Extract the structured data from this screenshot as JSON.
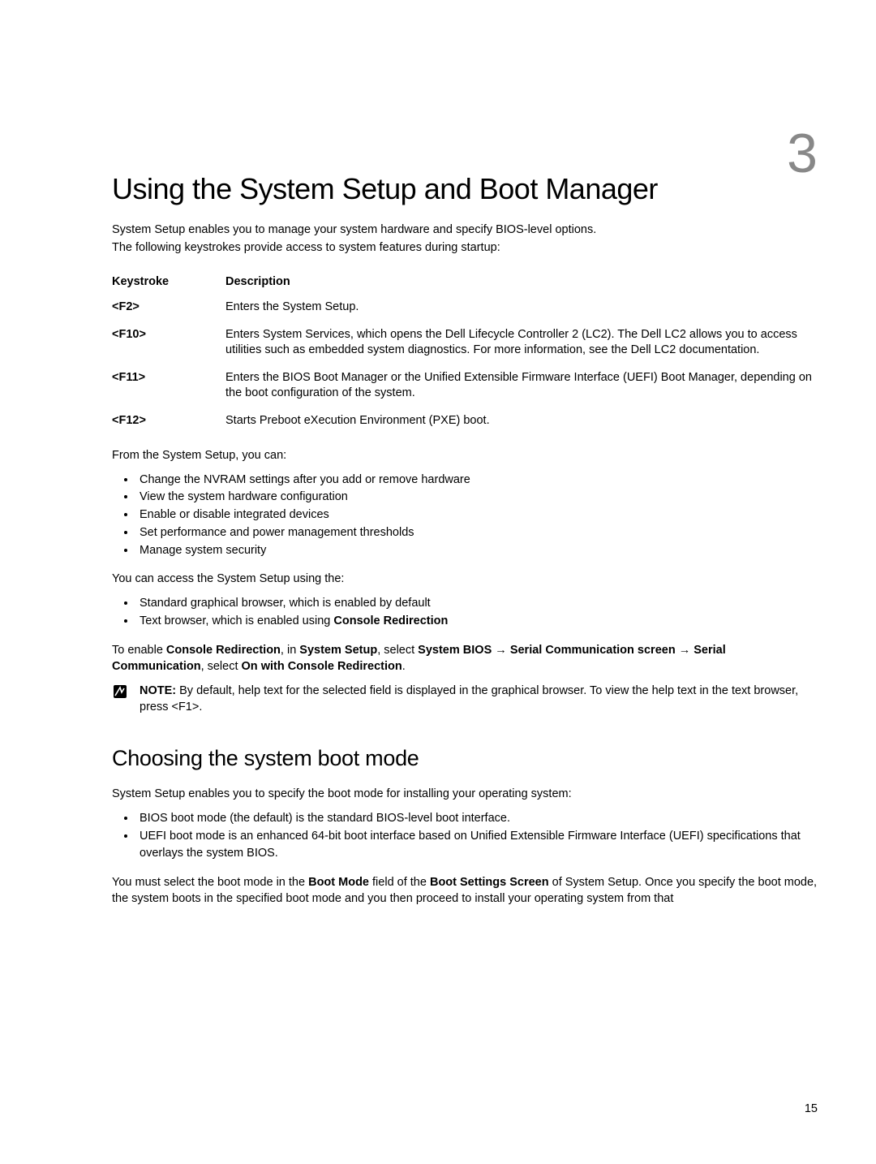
{
  "chapter_number": "3",
  "title": "Using the System Setup and Boot Manager",
  "intro": {
    "p1": "System Setup enables you to manage your system hardware and specify BIOS-level options.",
    "p2": "The following keystrokes provide access to system features during startup:"
  },
  "keystroke_table": {
    "headers": {
      "key": "Keystroke",
      "desc": "Description"
    },
    "rows": [
      {
        "key": "<F2>",
        "desc": "Enters the System Setup."
      },
      {
        "key": "<F10>",
        "desc": "Enters System Services, which opens the Dell Lifecycle Controller 2 (LC2). The Dell LC2 allows you to access utilities such as embedded system diagnostics. For more information, see the Dell LC2 documentation."
      },
      {
        "key": "<F11>",
        "desc": "Enters the BIOS Boot Manager or the Unified Extensible Firmware Interface (UEFI) Boot Manager, depending on the boot configuration of the system."
      },
      {
        "key": "<F12>",
        "desc": "Starts Preboot eXecution Environment (PXE) boot."
      }
    ]
  },
  "from_setup_intro": "From the System Setup, you can:",
  "setup_bullets": [
    "Change the NVRAM settings after you add or remove hardware",
    "View the system hardware configuration",
    "Enable or disable integrated devices",
    "Set performance and power management thresholds",
    "Manage system security"
  ],
  "access_intro": "You can access the System Setup using the:",
  "access_bullets_html": [
    "Standard graphical browser, which is enabled by default",
    "Text browser, which is enabled using <b>Console Redirection</b>"
  ],
  "enable_para_html": "To enable <b>Console Redirection</b>, in <b>System Setup</b>, select <b>System BIOS</b> <span class='arrow'>→</span> <b>Serial Communication screen</b> <span class='arrow'>→</span> <b>Serial Communication</b>, select <b>On with Console Redirection</b>.",
  "note": {
    "label": "NOTE:",
    "text": " By default, help text for the selected field is displayed in the graphical browser. To view the help text in the text browser, press <F1>."
  },
  "section2": {
    "heading": "Choosing the system boot mode",
    "p1": "System Setup enables you to specify the boot mode for installing your operating system:",
    "bullets": [
      "BIOS boot mode (the default) is the standard BIOS-level boot interface.",
      "UEFI boot mode is an enhanced 64-bit boot interface based on Unified Extensible Firmware Interface (UEFI) specifications that overlays the system BIOS."
    ],
    "p2_html": "You must select the boot mode in the <b>Boot Mode</b> field of the <b>Boot Settings Screen</b> of System Setup. Once you specify the boot mode, the system boots in the specified boot mode and you then proceed to install your operating system from that"
  },
  "page_number": "15"
}
